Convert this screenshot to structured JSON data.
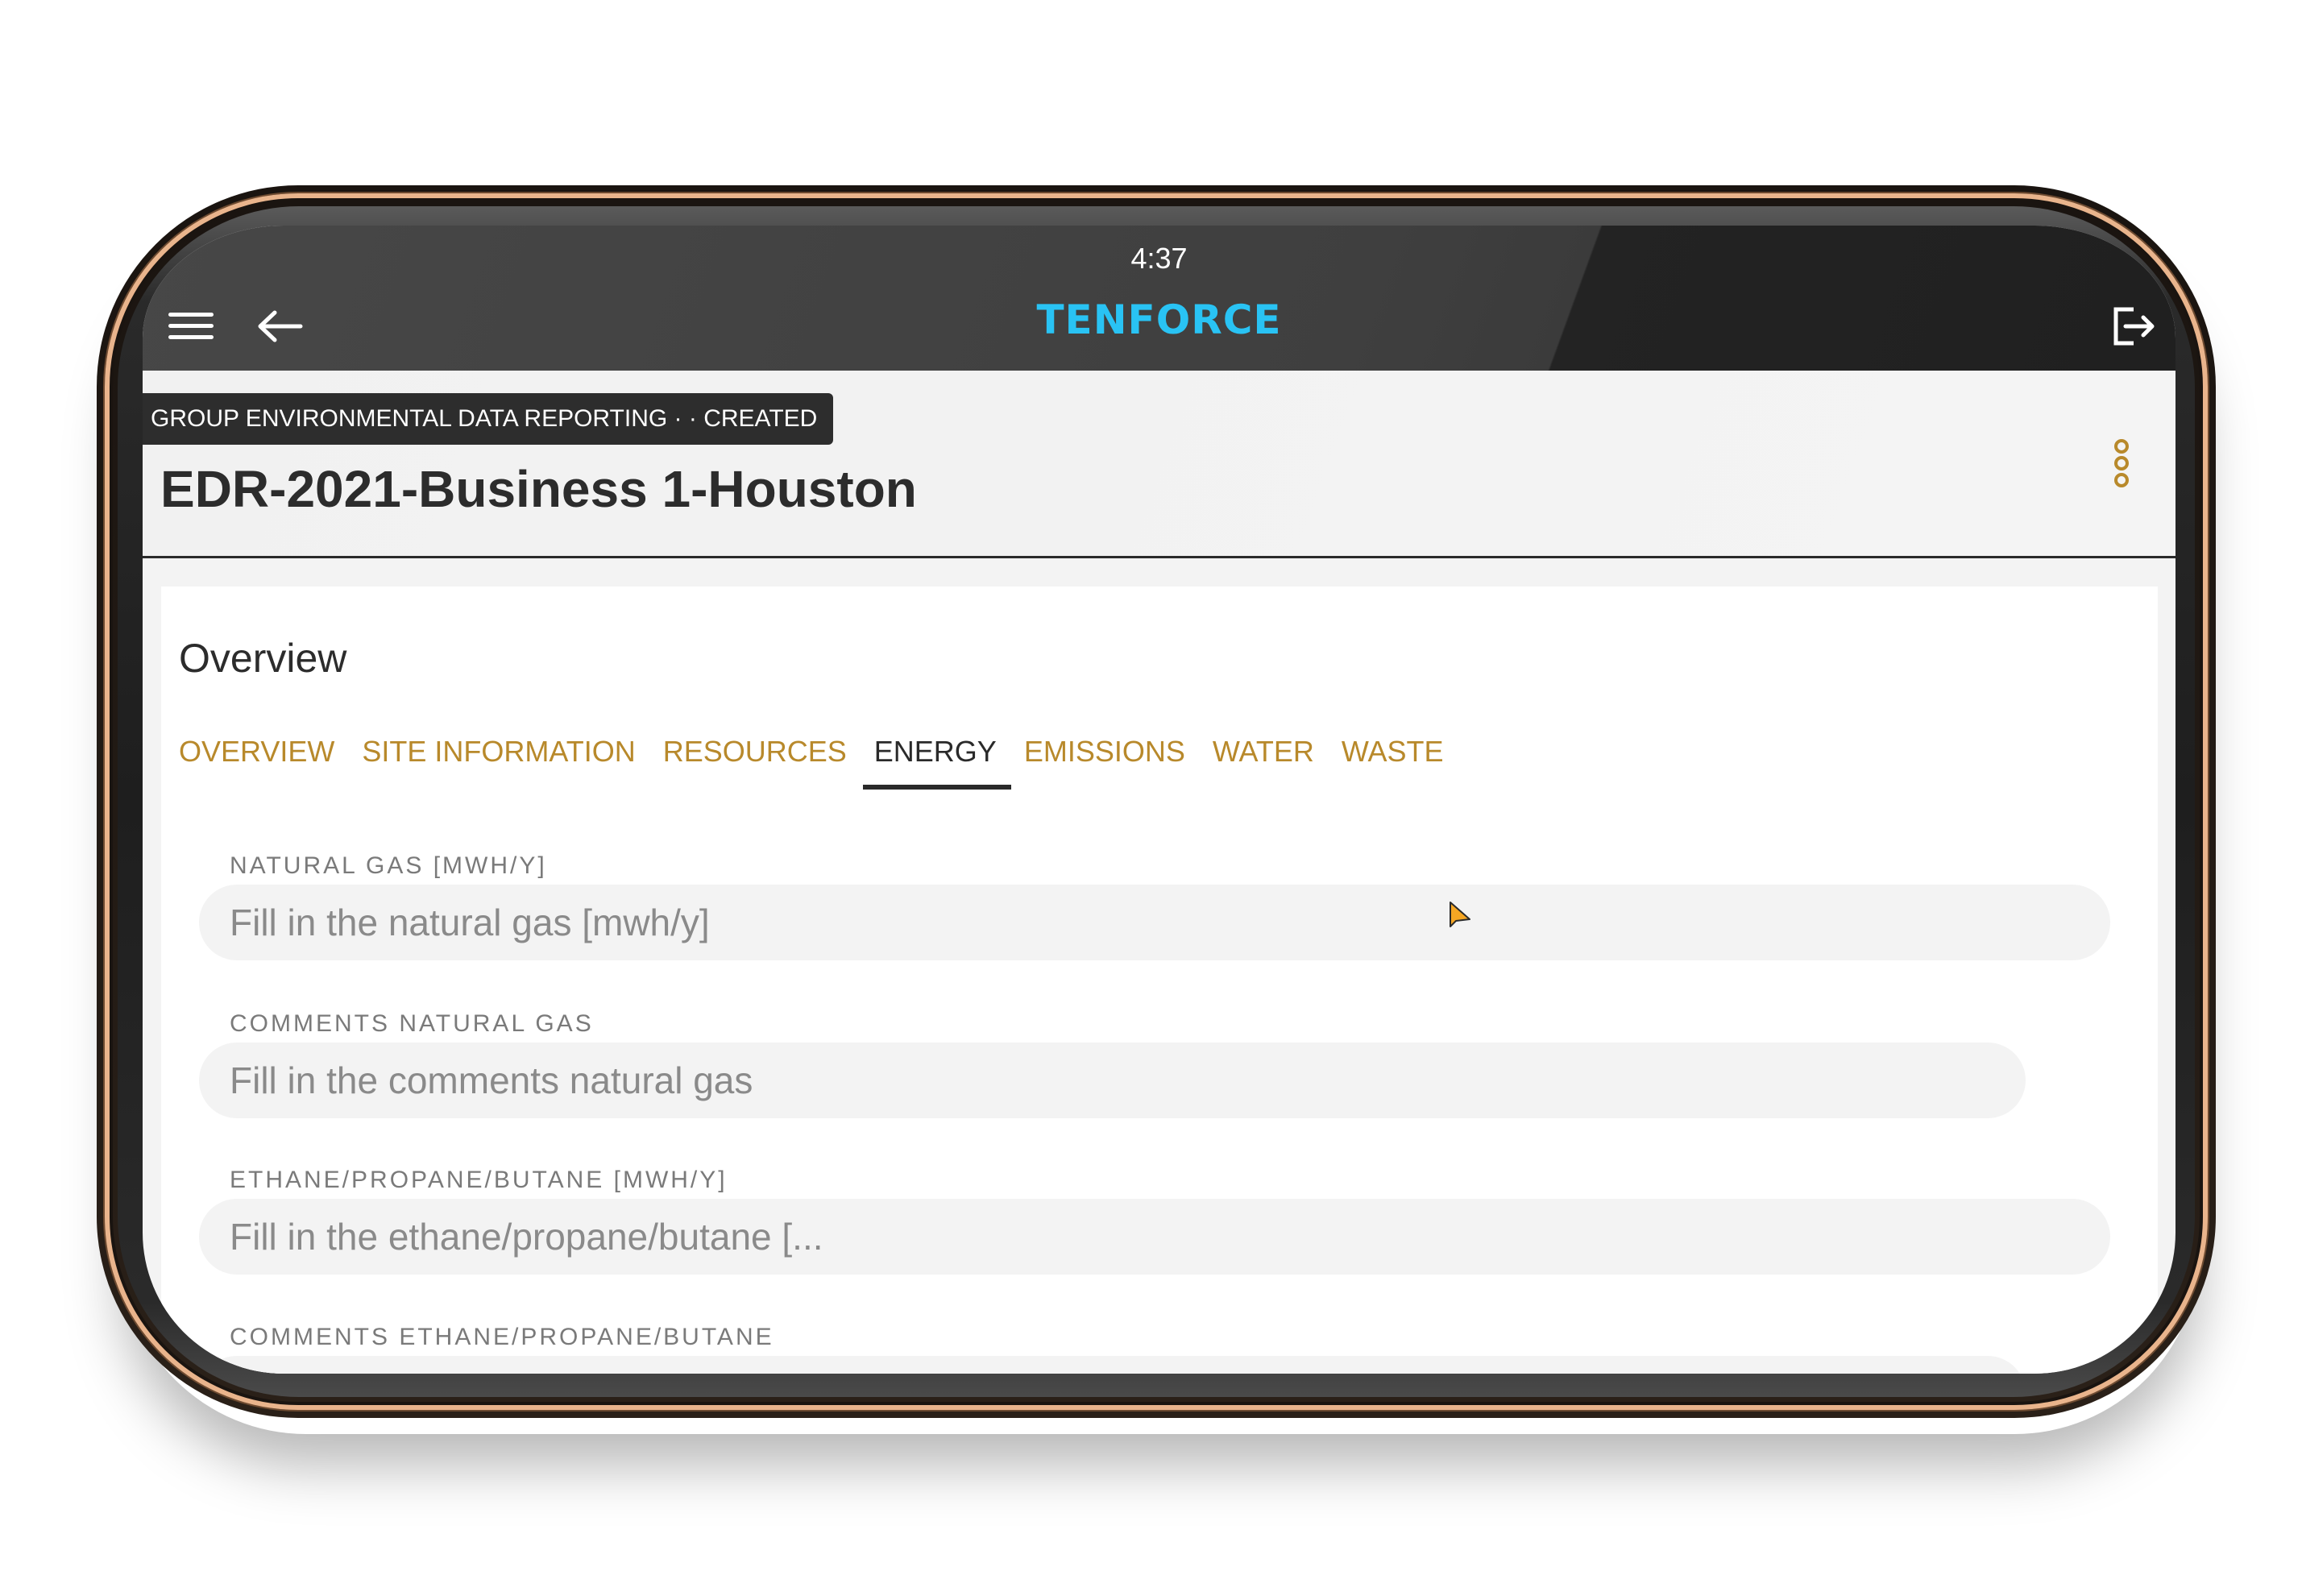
{
  "status_bar": {
    "time": "4:37"
  },
  "app_bar": {
    "brand": "TENFORCE",
    "brand_color": "#29c3f4",
    "icons": [
      "menu-icon",
      "back-arrow-icon",
      "logout-icon"
    ]
  },
  "header": {
    "badge": "GROUP ENVIRONMENTAL DATA REPORTING ·  · CREATED",
    "title": "EDR-2021-Business 1-Houston",
    "more_icon": "more-vertical-icon",
    "accent_color": "#b8892b"
  },
  "card": {
    "title": "Overview",
    "tabs": [
      {
        "label": "OVERVIEW",
        "active": false
      },
      {
        "label": "SITE INFORMATION",
        "active": false
      },
      {
        "label": "RESOURCES",
        "active": false
      },
      {
        "label": "ENERGY",
        "active": true
      },
      {
        "label": "EMISSIONS",
        "active": false
      },
      {
        "label": "WATER",
        "active": false
      },
      {
        "label": "WASTE",
        "active": false
      }
    ],
    "fields": [
      {
        "label": "NATURAL GAS [MWH/Y]",
        "placeholder": "Fill in the natural gas [mwh/y]",
        "value": ""
      },
      {
        "label": "COMMENTS NATURAL GAS",
        "placeholder": "Fill in the comments natural gas",
        "value": ""
      },
      {
        "label": "ETHANE/PROPANE/BUTANE [MWH/Y]",
        "placeholder": "Fill in the ethane/propane/butane [...",
        "value": ""
      },
      {
        "label": "COMMENTS ETHANE/PROPANE/BUTANE",
        "placeholder": "",
        "value": ""
      }
    ]
  }
}
